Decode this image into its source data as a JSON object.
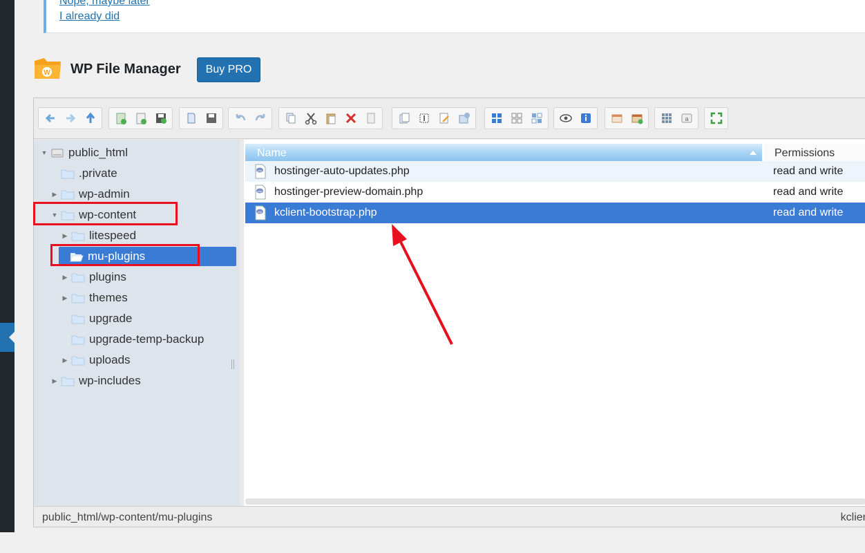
{
  "notice": {
    "link_later": "Nope, maybe later",
    "link_did": "I already did"
  },
  "header": {
    "title": "WP File Manager",
    "buy_pro": "Buy PRO"
  },
  "tree": {
    "root": "public_html",
    "items": [
      {
        "label": ".private",
        "expandable": false
      },
      {
        "label": "wp-admin",
        "expandable": true
      },
      {
        "label": "wp-content",
        "expandable": true,
        "expanded": true
      },
      {
        "label": "litespeed",
        "expandable": true
      },
      {
        "label": "mu-plugins",
        "expandable": false,
        "selected": true
      },
      {
        "label": "plugins",
        "expandable": true
      },
      {
        "label": "themes",
        "expandable": true
      },
      {
        "label": "upgrade",
        "expandable": false
      },
      {
        "label": "upgrade-temp-backup",
        "expandable": false
      },
      {
        "label": "uploads",
        "expandable": true
      },
      {
        "label": "wp-includes",
        "expandable": true
      }
    ]
  },
  "files": {
    "columns": {
      "name": "Name",
      "permissions": "Permissions"
    },
    "rows": [
      {
        "name": "hostinger-auto-updates.php",
        "permissions": "read and write"
      },
      {
        "name": "hostinger-preview-domain.php",
        "permissions": "read and write"
      },
      {
        "name": "kclient-bootstrap.php",
        "permissions": "read and write",
        "selected": true
      }
    ]
  },
  "status": {
    "path": "public_html/wp-content/mu-plugins",
    "selected": "kclient"
  },
  "colors": {
    "accent": "#2271b1",
    "selection": "#3a7bd5",
    "annotation": "#e8101e"
  },
  "toolbar_icons": [
    "back-icon",
    "forward-icon",
    "up-icon",
    "new-folder-icon",
    "new-file-icon",
    "save-icon",
    "open-icon",
    "download-icon",
    "undo-icon",
    "redo-icon",
    "copy-icon",
    "cut-icon",
    "paste-icon",
    "delete-icon",
    "empty-icon",
    "duplicate-icon",
    "rename-icon",
    "edit-icon",
    "resize-icon",
    "view-icons-icon",
    "view-list-icon",
    "view-details-icon",
    "preview-icon",
    "info-icon",
    "extract-icon",
    "archive-icon",
    "select-all-icon",
    "help-icon",
    "fullscreen-icon"
  ]
}
